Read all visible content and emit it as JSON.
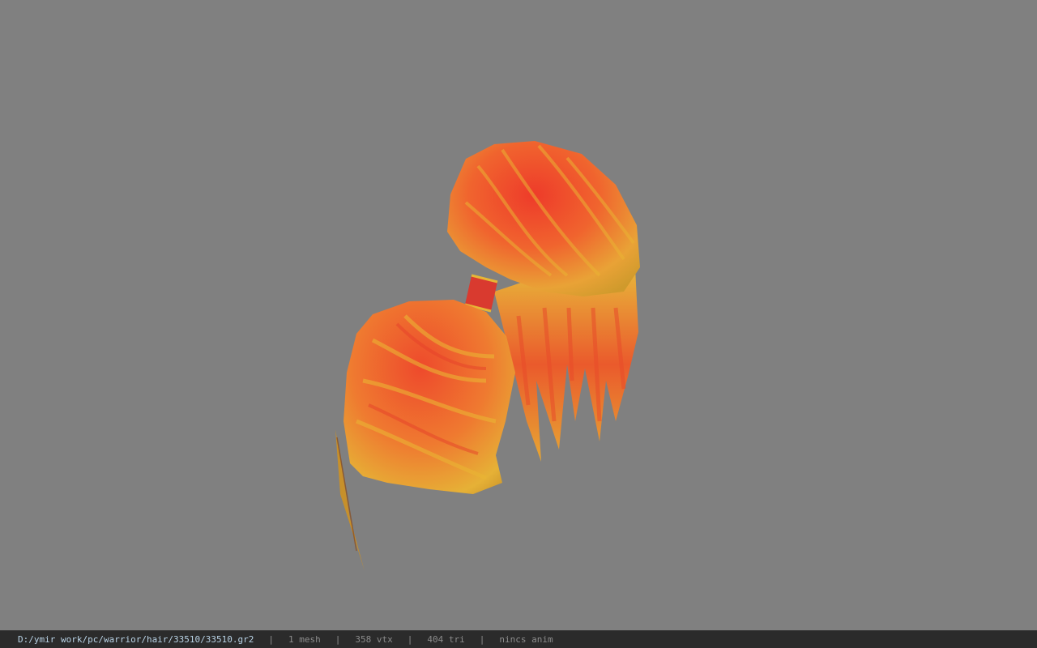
{
  "viewer": {
    "background_color": "#808080",
    "model": {
      "name": "hair-mesh",
      "colors": {
        "red": "#e8402a",
        "orange": "#f08a2a",
        "yellow": "#e8c23a",
        "tie": "#d93a2f"
      }
    }
  },
  "status_bar": {
    "file_path": "D:/ymir work/pc/warrior/hair/33510/33510.gr2",
    "mesh_count": "1 mesh",
    "vertex_count": "358 vtx",
    "triangle_count": "404 tri",
    "animation_status": "nincs anim",
    "separator": "|"
  }
}
